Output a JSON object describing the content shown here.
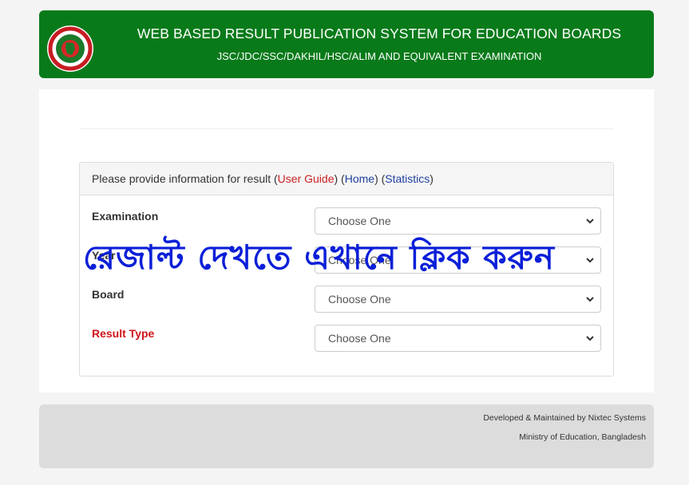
{
  "header": {
    "title": "WEB BASED RESULT PUBLICATION SYSTEM FOR EDUCATION BOARDS",
    "subtitle": "JSC/JDC/SSC/DAKHIL/HSC/ALIM AND EQUIVALENT EXAMINATION",
    "logo_icon": "bangladesh-government-seal"
  },
  "panel": {
    "intro": "Please provide information for result",
    "user_guide": "User Guide",
    "home": "Home",
    "statistics": "Statistics"
  },
  "form": {
    "examination_label": "Examination",
    "examination_value": "Choose One",
    "year_label": "Year",
    "year_value": "Choose One",
    "board_label": "Board",
    "board_value": "Choose One",
    "result_type_label": "Result Type",
    "result_type_value": "Choose One"
  },
  "overlay": {
    "text": "রেজাল্ট দেখতে এখানে ক্লিক করুন"
  },
  "footer": {
    "developer": "Developed & Maintained by Nixtec Systems",
    "ministry": "Ministry of Education, Bangladesh"
  },
  "colors": {
    "header_green": "#097a1a",
    "link_red": "#cc1f1f",
    "link_blue": "#1d3f9e",
    "overlay_blue": "#0b1fd8"
  }
}
